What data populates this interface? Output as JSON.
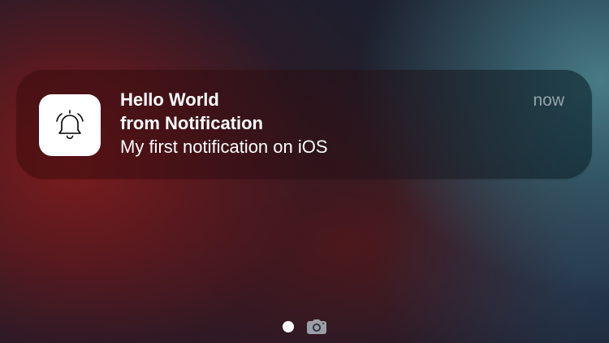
{
  "notification": {
    "title_line1": "Hello World",
    "title_line2": "from Notification",
    "body": "My first notification on iOS",
    "time": "now",
    "app_icon": "bell-icon"
  },
  "page_indicator": {
    "current_page_icon": "page-dot",
    "camera_icon": "camera-icon"
  },
  "colors": {
    "notification_text": "#ffffff",
    "time_text": "#c6ccd1",
    "app_icon_background": "#ffffff",
    "wallpaper_red": "#801c1c",
    "wallpaper_teal": "#4a808a",
    "wallpaper_dark": "#1d1f2e"
  }
}
